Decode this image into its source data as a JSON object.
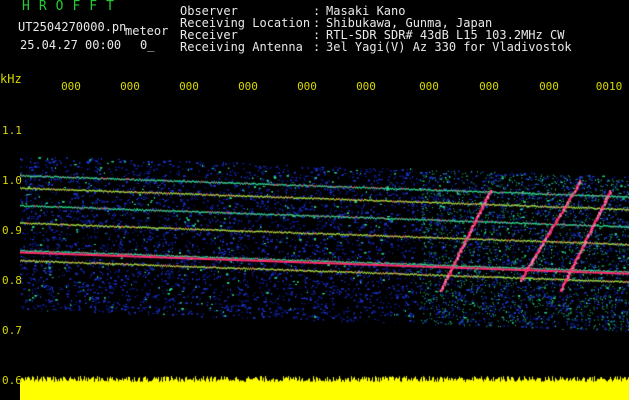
{
  "header": {
    "app_name": "HROFFT",
    "file_name": "UT2504270000.pn",
    "mode": "meteor",
    "datetime": "25.04.27 00:00",
    "zoom_readout": "0_"
  },
  "info": [
    {
      "label": "Observer",
      "value": "Masaki Kano"
    },
    {
      "label": "Receiving Location",
      "value": "Shibukawa, Gunma, Japan"
    },
    {
      "label": "Receiver",
      "value": "RTL-SDR SDR# 43dB L15 103.2MHz CW"
    },
    {
      "label": "Receiving Antenna",
      "value": "3el Yagi(V) Az 330 for Vladivostok"
    }
  ],
  "axis": {
    "unit": "kHz",
    "y_ticks": [
      "1.1",
      "1.0",
      "0.9",
      "0.8",
      "0.7",
      "0.6"
    ],
    "x_ticks": [
      "000",
      "000",
      "000",
      "000",
      "000",
      "000",
      "000",
      "000",
      "000",
      "0010"
    ]
  },
  "colors": {
    "background": "#000000",
    "text": "#e8e8e8",
    "app_name": "#22cc33",
    "axis_text": "#d8d800",
    "baseline_noise": "#ffff00",
    "signal_strong": "#ff2b6e",
    "signal_mid": "#29d68f",
    "signal_weak": "#1e36c8"
  },
  "spectrum": {
    "band_top_khz": 1.05,
    "band_bottom_khz": 0.74,
    "strong_traces_khz": [
      1.01,
      0.985,
      0.95,
      0.915,
      0.86,
      0.84
    ],
    "meteor_streaks": [
      {
        "start_khz": 0.98,
        "end_khz": 0.78
      },
      {
        "start_khz": 1.0,
        "end_khz": 0.8
      }
    ]
  }
}
